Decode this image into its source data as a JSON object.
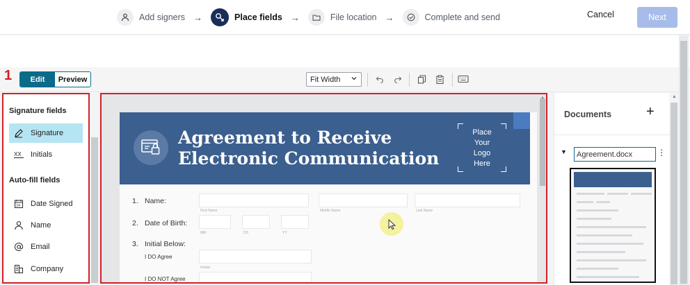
{
  "steps": [
    {
      "label": "Add signers",
      "icon": "person-icon",
      "active": false
    },
    {
      "label": "Place fields",
      "icon": "place-fields-icon",
      "active": true
    },
    {
      "label": "File location",
      "icon": "folder-icon",
      "active": false
    },
    {
      "label": "Complete and send",
      "icon": "check-circle-icon",
      "active": false
    }
  ],
  "header": {
    "cancel_label": "Cancel",
    "next_label": "Next"
  },
  "toolbar": {
    "marker": "1",
    "edit_label": "Edit",
    "preview_label": "Preview",
    "zoom_value": "Fit Width"
  },
  "left_panel": {
    "signature_section": "Signature fields",
    "signature_items": [
      {
        "label": "Signature",
        "icon": "pen-icon",
        "active": true
      },
      {
        "label": "Initials",
        "icon": "initials-icon",
        "active": false
      }
    ],
    "autofill_section": "Auto-fill fields",
    "autofill_items": [
      {
        "label": "Date Signed",
        "icon": "calendar-icon"
      },
      {
        "label": "Name",
        "icon": "person-icon"
      },
      {
        "label": "Email",
        "icon": "at-icon"
      },
      {
        "label": "Company",
        "icon": "building-icon"
      }
    ]
  },
  "document": {
    "title_line1": "Agreement to Receive",
    "title_line2": "Electronic Communication",
    "logo_text": "Place Your Logo Here",
    "rows": [
      {
        "num": "1.",
        "label": "Name:"
      },
      {
        "num": "2.",
        "label": "Date of Birth:"
      },
      {
        "num": "3.",
        "label": "Initial Below:"
      }
    ],
    "name_hints": [
      "First Name",
      "Middle Name",
      "Last Name"
    ],
    "dob_hints": [
      "MM",
      "DD",
      "YY"
    ],
    "initial_options": [
      "I DO Agree",
      "I DO NOT Agree"
    ],
    "initial_hint": "Initials"
  },
  "right_panel": {
    "title": "Documents",
    "add_label": "+",
    "document_name": "Agreement.docx"
  },
  "colors": {
    "brand_navy": "#1a2d5a",
    "teal": "#0a6b8a",
    "highlight": "#b5e5f2",
    "next_disabled": "#a7bce8",
    "banner_blue": "#3b5f8f",
    "annotation_red": "#d31f26"
  }
}
